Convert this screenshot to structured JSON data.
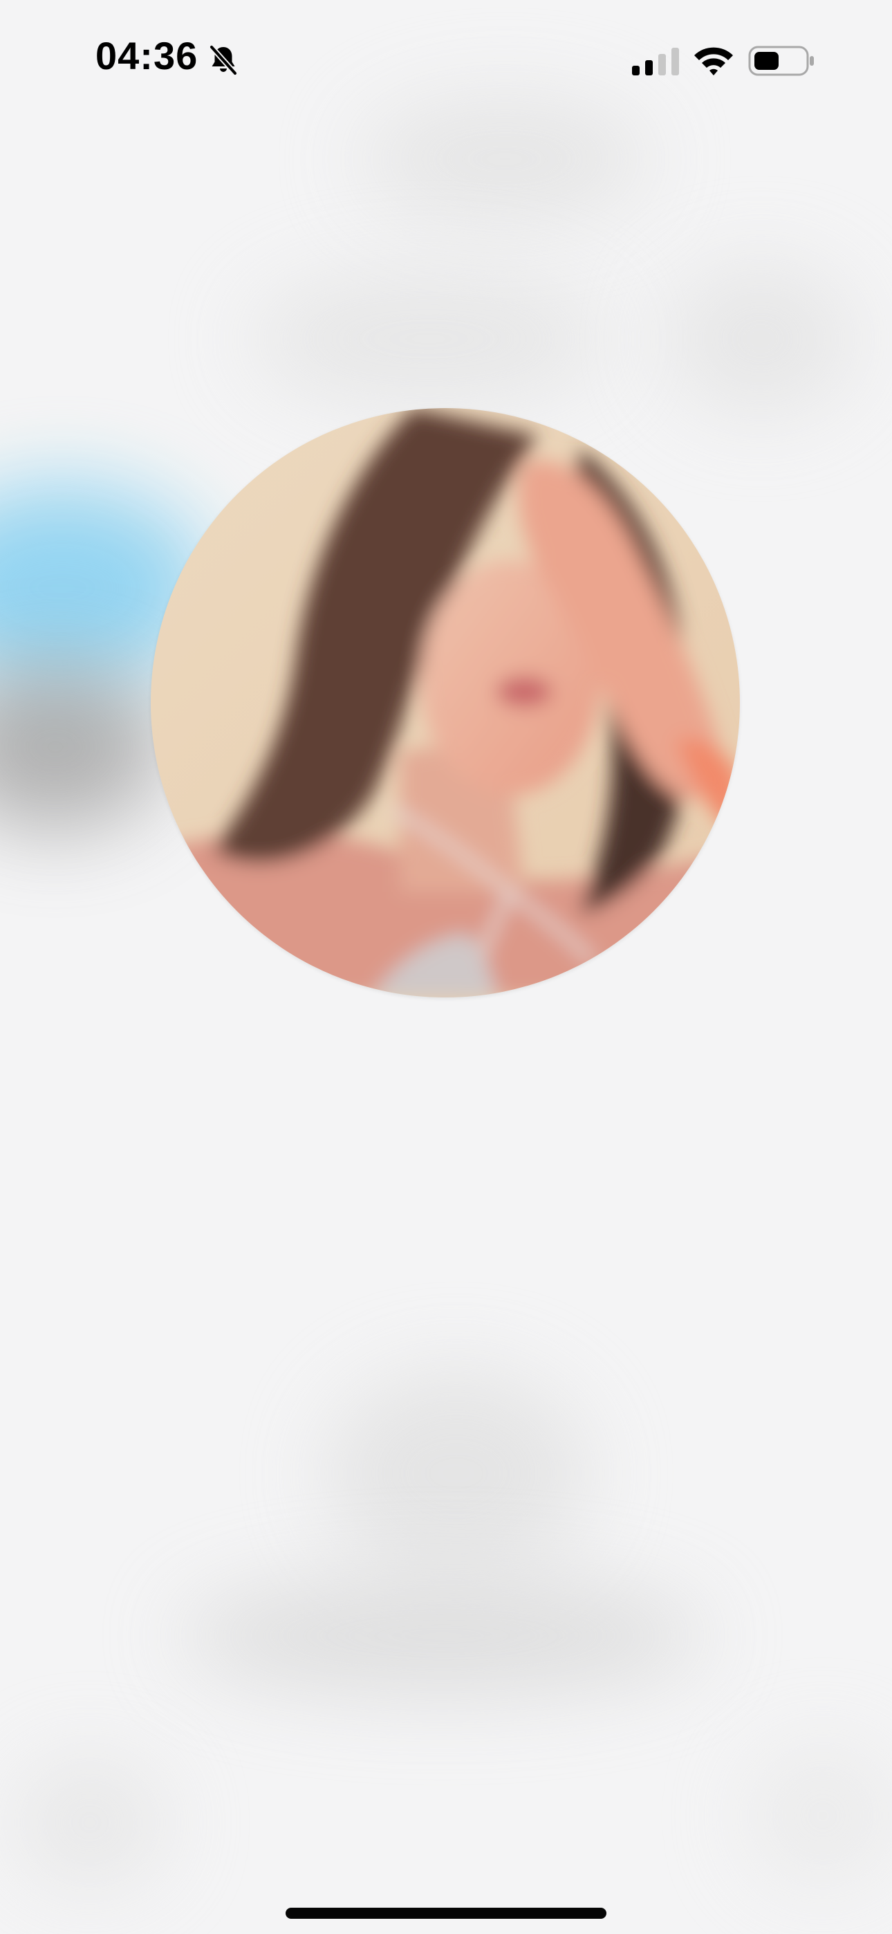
{
  "status_bar": {
    "time": "04:36",
    "icons": [
      "bell-slash-icon",
      "cellular-signal-icon",
      "wifi-icon",
      "battery-icon"
    ]
  },
  "profile": {
    "avatar_icon": "profile-photo"
  },
  "colors": {
    "background": "#f4f4f5",
    "text": "#000000",
    "blue_blob": "#8fd3f1"
  }
}
